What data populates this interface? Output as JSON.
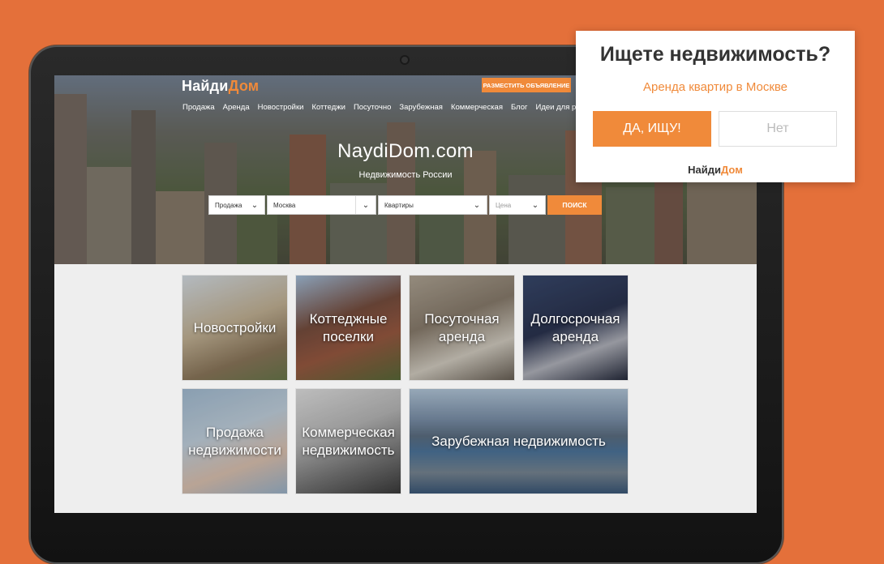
{
  "site": {
    "logo_main": "Найди",
    "logo_accent": "Дом",
    "post_button": "РАЗМЕСТИТЬ ОБЪЯВЛЕНИЕ",
    "nav": [
      "Продажа",
      "Аренда",
      "Новостройки",
      "Коттеджи",
      "Посуточно",
      "Зарубежная",
      "Коммерческая",
      "Блог",
      "Идеи для ремонта"
    ],
    "hero_title": "NaydiDom.com",
    "hero_subtitle": "Недвижимость России"
  },
  "search": {
    "deal": "Продажа",
    "city": "Москва",
    "type": "Квартиры",
    "price_placeholder": "Цена",
    "button": "ПОИСК"
  },
  "tiles": [
    {
      "label": "Новостройки"
    },
    {
      "label": "Коттеджные поселки"
    },
    {
      "label": "Посуточная аренда"
    },
    {
      "label": "Долгосрочная аренда"
    },
    {
      "label": "Продажа недвижимости"
    },
    {
      "label": "Коммерческая недвижимость"
    },
    {
      "label": "Зарубежная недвижимость"
    }
  ],
  "popup": {
    "question": "Ищете недвижимость?",
    "link": "Аренда квартир в Москве",
    "yes": "ДА, ИЩУ!",
    "no": "Нет",
    "logo_main": "Найди",
    "logo_accent": "Дом"
  },
  "colors": {
    "background": "#e4703a",
    "accent": "#f08a3a"
  }
}
